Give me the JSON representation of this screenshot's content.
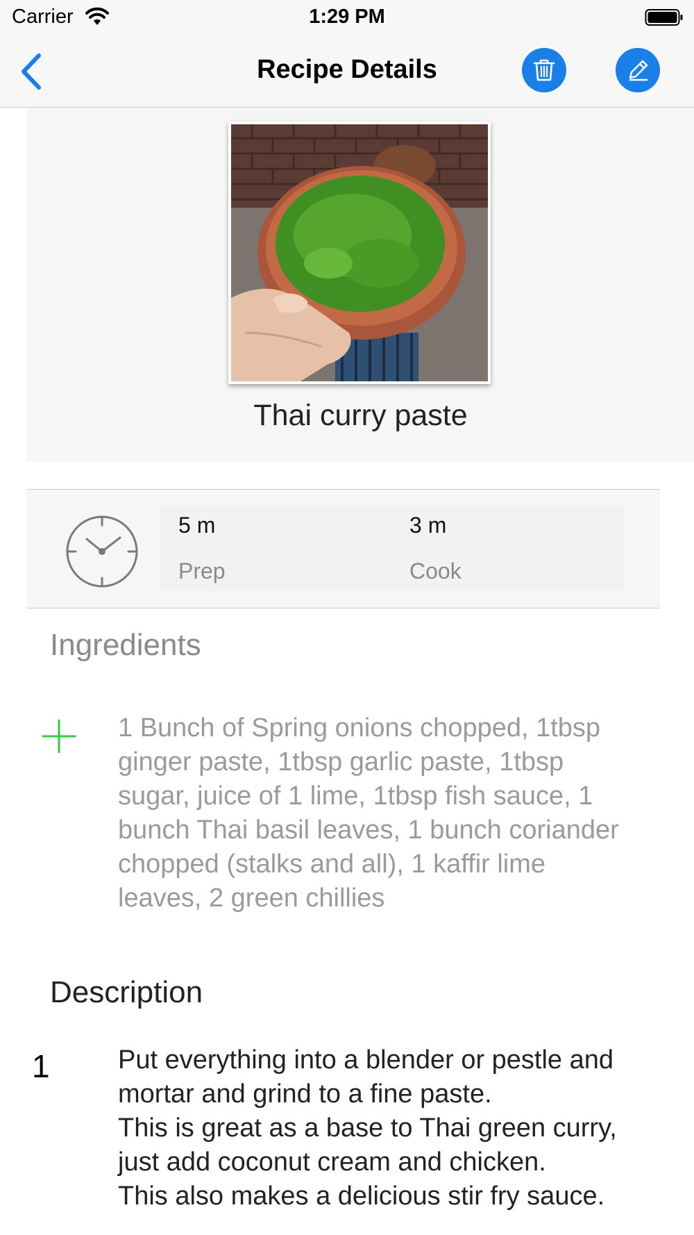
{
  "status_bar": {
    "carrier": "Carrier",
    "time": "1:29 PM"
  },
  "nav": {
    "title": "Recipe Details",
    "accent_color": "#1a7fe8"
  },
  "recipe": {
    "name": "Thai curry paste",
    "prep": {
      "value": "5 m",
      "label": "Prep"
    },
    "cook": {
      "value": "3 m",
      "label": "Cook"
    }
  },
  "ingredients": {
    "heading": "Ingredients",
    "text": "1 Bunch of Spring onions chopped, 1tbsp\nginger paste, 1tbsp garlic paste, 1tbsp\nsugar, juice of 1 lime, 1tbsp fish sauce, 1\nbunch Thai basil leaves, 1 bunch coriander\nchopped (stalks and all), 1 kaffir lime\nleaves, 2 green chillies"
  },
  "description": {
    "heading": "Description",
    "steps": [
      {
        "number": "1",
        "text": "Put everything into a blender or pestle and\nmortar and grind to a fine paste.\nThis is great as a base to Thai green curry,\njust add coconut cream and chicken.\nThis also makes a delicious stir fry sauce."
      }
    ]
  }
}
